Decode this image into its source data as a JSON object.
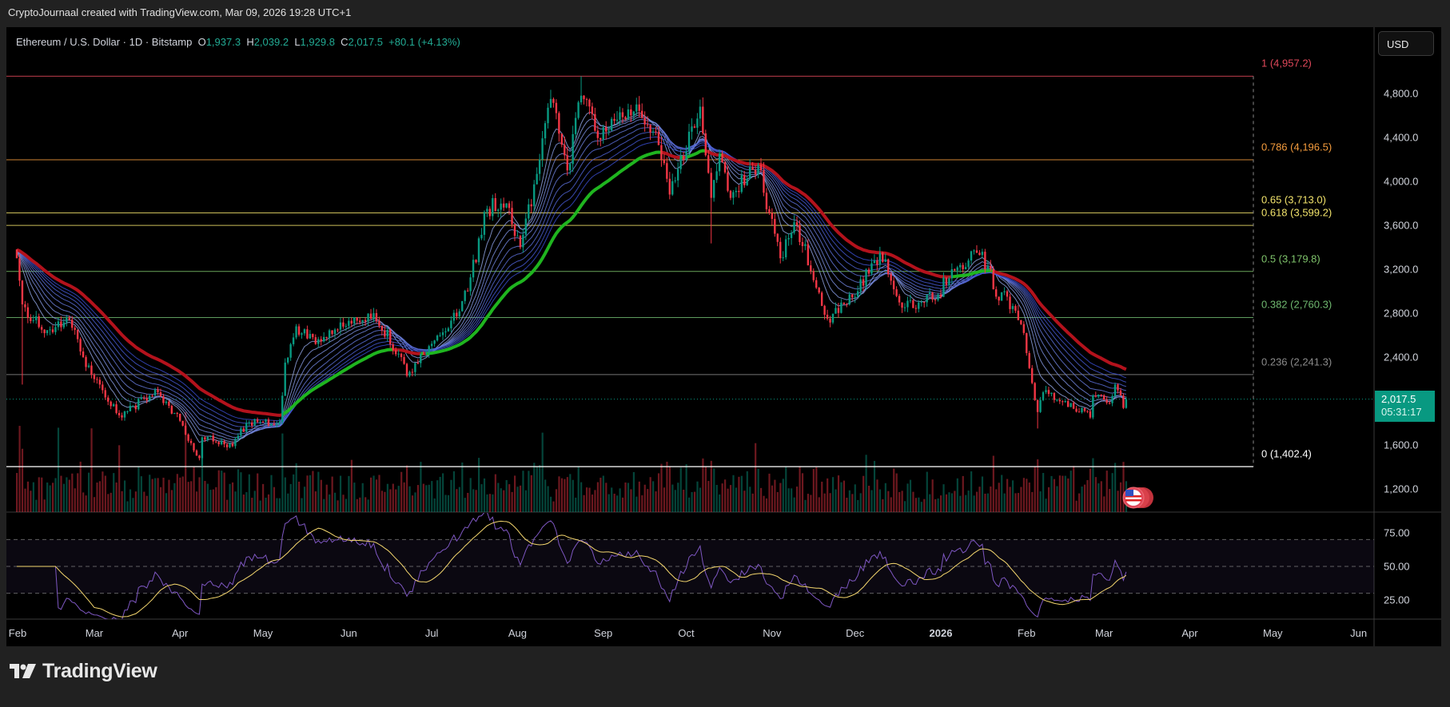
{
  "header": {
    "creator_line": "CryptoJournaal created with TradingView.com, Mar 09, 2026 19:28 UTC+1"
  },
  "legend": {
    "symbol": "Ethereum / U.S. Dollar · 1D · Bitstamp",
    "o_label": "O",
    "o": "1,937.3",
    "h_label": "H",
    "h": "2,039.2",
    "l_label": "L",
    "l": "1,929.8",
    "c_label": "C",
    "c": "2,017.5",
    "change": "+80.1 (+4.13%)"
  },
  "price_axis": {
    "currency_button": "USD",
    "last_price": "2,017.5",
    "countdown": "05:31:17"
  },
  "branding": {
    "logo_text": "TradingView"
  },
  "colors": {
    "up": "#089981",
    "down": "#f23645",
    "ema_bull": "#1fb51f",
    "ema_bear": "#b3121c",
    "rsi": "#7e57c2",
    "rsi_ma": "#f5d76e"
  },
  "chart_data": {
    "type": "candlestick",
    "title": "Ethereum / U.S. Dollar · 1D · Bitstamp",
    "x_unit": "days since 2025-02-01",
    "y_ticks": [
      "4,800.0",
      "4,400.0",
      "4,000.0",
      "3,600.0",
      "3,200.0",
      "2,800.0",
      "2,400.0",
      "1,600.0",
      "1,200.0"
    ],
    "y_tick_values": [
      4800,
      4400,
      4000,
      3600,
      3200,
      2800,
      2400,
      1600,
      1200
    ],
    "ylim": [
      1130,
      5320
    ],
    "x_ticks": [
      {
        "label": "Feb",
        "day": 0
      },
      {
        "label": "Mar",
        "day": 28
      },
      {
        "label": "Apr",
        "day": 59
      },
      {
        "label": "May",
        "day": 89
      },
      {
        "label": "Jun",
        "day": 120
      },
      {
        "label": "Jul",
        "day": 150
      },
      {
        "label": "Aug",
        "day": 181
      },
      {
        "label": "Sep",
        "day": 212
      },
      {
        "label": "Oct",
        "day": 242
      },
      {
        "label": "Nov",
        "day": 273
      },
      {
        "label": "Dec",
        "day": 303
      },
      {
        "label": "2026",
        "day": 334
      },
      {
        "label": "Feb",
        "day": 365
      },
      {
        "label": "Mar",
        "day": 393
      },
      {
        "label": "Apr",
        "day": 424
      },
      {
        "label": "May",
        "day": 454
      },
      {
        "label": "Jun",
        "day": 485
      }
    ],
    "approx_close_path": [
      [
        0,
        3300
      ],
      [
        2,
        2880,
        2150
      ],
      [
        9,
        2650
      ],
      [
        19,
        2740
      ],
      [
        24,
        2400
      ],
      [
        28,
        2200
      ],
      [
        30,
        2150
      ],
      [
        37,
        1870
      ],
      [
        51,
        2080
      ],
      [
        59,
        1820
      ],
      [
        66,
        1480
      ],
      [
        67,
        1670,
        1402.4
      ],
      [
        78,
        1590
      ],
      [
        83,
        1800
      ],
      [
        95,
        1810
      ],
      [
        97,
        2350
      ],
      [
        101,
        2680
      ],
      [
        108,
        2520
      ],
      [
        116,
        2650
      ],
      [
        129,
        2800
      ],
      [
        139,
        2400
      ],
      [
        141,
        2230
      ],
      [
        149,
        2500
      ],
      [
        159,
        2770
      ],
      [
        163,
        3000
      ],
      [
        170,
        3750
      ],
      [
        177,
        3800
      ],
      [
        182,
        3400
      ],
      [
        189,
        4200
      ],
      [
        193,
        4750
      ],
      [
        199,
        4100
      ],
      [
        204,
        4780,
        null,
        4957.2
      ],
      [
        211,
        4380
      ],
      [
        224,
        4700
      ],
      [
        231,
        4450
      ],
      [
        236,
        3880
      ],
      [
        244,
        4500
      ],
      [
        247,
        4680
      ],
      [
        251,
        3850,
        3435
      ],
      [
        254,
        4250
      ],
      [
        258,
        3850
      ],
      [
        268,
        4150
      ],
      [
        276,
        3300
      ],
      [
        282,
        3600
      ],
      [
        293,
        2750
      ],
      [
        304,
        3000
      ],
      [
        312,
        3350
      ],
      [
        320,
        2850
      ],
      [
        333,
        2970
      ],
      [
        338,
        3200
      ],
      [
        347,
        3350
      ],
      [
        352,
        3200
      ],
      [
        354,
        2950
      ],
      [
        358,
        2950
      ],
      [
        363,
        2700
      ],
      [
        366,
        2300
      ],
      [
        369,
        1900,
        1750
      ],
      [
        371,
        2080
      ],
      [
        379,
        2000
      ],
      [
        388,
        1850
      ],
      [
        389,
        2050
      ],
      [
        395,
        1980
      ],
      [
        397,
        2150
      ],
      [
        400,
        1937.3
      ]
    ],
    "last_candle": {
      "day": 401,
      "open": 1937.3,
      "high": 2039.2,
      "low": 1929.8,
      "close": 2017.5
    },
    "fib_levels": [
      {
        "level": "1",
        "price": 4957.2,
        "label": "1 (4,957.2)",
        "color": "#e0485a"
      },
      {
        "level": "0.786",
        "price": 4196.5,
        "label": "0.786 (4,196.5)",
        "color": "#f59c3d"
      },
      {
        "level": "0.65",
        "price": 3713.0,
        "label": "0.65 (3,713.0)",
        "color": "#f2e36b"
      },
      {
        "level": "0.618",
        "price": 3599.2,
        "label": "0.618 (3,599.2)",
        "color": "#f2e36b"
      },
      {
        "level": "0.5",
        "price": 3179.8,
        "label": "0.5 (3,179.8)",
        "color": "#7fc36b"
      },
      {
        "level": "0.382",
        "price": 2760.3,
        "label": "0.382 (2,760.3)",
        "color": "#6fb86f"
      },
      {
        "level": "0.236",
        "price": 2241.3,
        "label": "0.236 (2,241.3)",
        "color": "#8a8a8a"
      },
      {
        "level": "0",
        "price": 1402.4,
        "label": "0 (1,402.4)",
        "color": "#ffffff"
      }
    ],
    "ema_ribbon_periods": [
      8,
      12,
      16,
      20,
      25,
      30,
      35,
      40,
      45
    ],
    "ema_main_period": 55,
    "rsi": {
      "period": 14,
      "ma_period": 14,
      "ticks": [
        "75.00",
        "50.00",
        "25.00"
      ],
      "tick_values": [
        75,
        50,
        25
      ],
      "upper": 70,
      "middle": 50,
      "lower": 30
    }
  }
}
